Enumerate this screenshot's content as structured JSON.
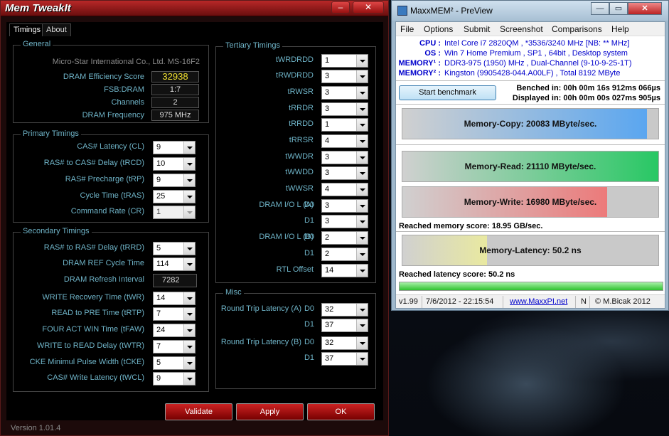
{
  "memtweakit": {
    "title": "Mem TweakIt",
    "tabs": [
      "Timings",
      "About"
    ],
    "general": {
      "label": "General",
      "board": "Micro-Star International Co., Ltd. MS-16F2",
      "rows": [
        {
          "label": "DRAM Efficiency Score",
          "value": "32938"
        },
        {
          "label": "FSB:DRAM",
          "value": "1:7"
        },
        {
          "label": "Channels",
          "value": "2"
        },
        {
          "label": "DRAM Frequency",
          "value": "975 MHz"
        }
      ]
    },
    "primary": {
      "label": "Primary Timings",
      "rows": [
        {
          "label": "CAS# Latency (CL)",
          "value": "9"
        },
        {
          "label": "RAS# to CAS# Delay (tRCD)",
          "value": "10"
        },
        {
          "label": "RAS# Precharge (tRP)",
          "value": "9"
        },
        {
          "label": "Cycle Time (tRAS)",
          "value": "25"
        },
        {
          "label": "Command Rate (CR)",
          "value": "1"
        }
      ]
    },
    "secondary": {
      "label": "Secondary Timings",
      "rows": [
        {
          "label": "RAS# to RAS# Delay (tRRD)",
          "value": "5"
        },
        {
          "label": "DRAM REF Cycle Time",
          "value": "114"
        },
        {
          "label": "DRAM Refresh Interval",
          "value": "7282"
        },
        {
          "label": "WRITE Recovery Time (tWR)",
          "value": "14"
        },
        {
          "label": "READ to PRE Time (tRTP)",
          "value": "7"
        },
        {
          "label": "FOUR ACT WIN Time (tFAW)",
          "value": "24"
        },
        {
          "label": "WRITE to READ Delay (tWTR)",
          "value": "7"
        },
        {
          "label": "CKE Minimul Pulse Width (tCKE)",
          "value": "5"
        },
        {
          "label": "CAS# Write Latency (tWCL)",
          "value": "9"
        }
      ]
    },
    "tertiary": {
      "label": "Tertiary Timings",
      "rows": [
        {
          "label": "tWRDRDD",
          "value": "1"
        },
        {
          "label": "tRWDRDD",
          "value": "3"
        },
        {
          "label": "tRWSR",
          "value": "3"
        },
        {
          "label": "tRRDR",
          "value": "3"
        },
        {
          "label": "tRRDD",
          "value": "1"
        },
        {
          "label": "tRRSR",
          "value": "4"
        },
        {
          "label": "tWWDR",
          "value": "3"
        },
        {
          "label": "tWWDD",
          "value": "3"
        },
        {
          "label": "tWWSR",
          "value": "4"
        },
        {
          "label": "DRAM I/O L (A)",
          "sub": "D0",
          "value": "3"
        },
        {
          "label": "",
          "sub": "D1",
          "value": "3"
        },
        {
          "label": "DRAM I/O L (B)",
          "sub": "D0",
          "value": "2"
        },
        {
          "label": "",
          "sub": "D1",
          "value": "2"
        },
        {
          "label": "RTL Offset",
          "value": "14"
        }
      ]
    },
    "misc": {
      "label": "Misc",
      "rows": [
        {
          "label": "Round Trip Latency (A)",
          "sub": "D0",
          "value": "32"
        },
        {
          "label": "",
          "sub": "D1",
          "value": "37"
        },
        {
          "label": "Round Trip Latency (B)",
          "sub": "D0",
          "value": "32"
        },
        {
          "label": "",
          "sub": "D1",
          "value": "37"
        }
      ]
    },
    "buttons": {
      "validate": "Validate",
      "apply": "Apply",
      "ok": "OK"
    },
    "version": "Version 1.01.4"
  },
  "maxxmem": {
    "title": "MaxxMEM² - PreView",
    "menu": [
      "File",
      "Options",
      "Submit",
      "Screenshot",
      "Comparisons",
      "Help"
    ],
    "info": [
      {
        "key": "CPU :",
        "value": "Intel Core i7 2820QM , *3536/3240 MHz  [NB: ** MHz]"
      },
      {
        "key": "OS :",
        "value": "Win 7 Home Premium , SP1 , 64bit , Desktop system"
      },
      {
        "key": "MEMORY¹ :",
        "value": "DDR3-975 (1950) MHz , Dual-Channel (9-10-9-25-1T)"
      },
      {
        "key": "MEMORY² :",
        "value": "Kingston (9905428-044.A00LF) , Total 8192 MByte"
      }
    ],
    "start_button": "Start benchmark",
    "benched": "Benched in: 00h 00m 16s 912ms 066µs",
    "displayed": "Displayed in: 00h 00m 00s 027ms 905µs",
    "bars": [
      {
        "label": "Memory-Copy: 20083 MByte/sec.",
        "fill": 0.955,
        "color": "#5aa6f0"
      },
      {
        "label": "Memory-Read: 21110 MByte/sec.",
        "fill": 1.0,
        "color": "#28c864"
      },
      {
        "label": "Memory-Write: 16980 MByte/sec.",
        "fill": 0.8,
        "color": "#ec7a7a"
      }
    ],
    "reached_memory": "Reached memory score: 18.95 GB/sec.",
    "latency_bar": {
      "label": "Memory-Latency: 50.2 ns",
      "fill": 0.33,
      "color": "#e9e9a0"
    },
    "reached_latency": "Reached latency score: 50.2 ns",
    "status": {
      "version": "v1.99",
      "datetime": "7/6/2012 - 22:15:54",
      "url": "www.MaxxPI.net",
      "flag": "N",
      "author": "© M.Bicak 2012"
    }
  }
}
